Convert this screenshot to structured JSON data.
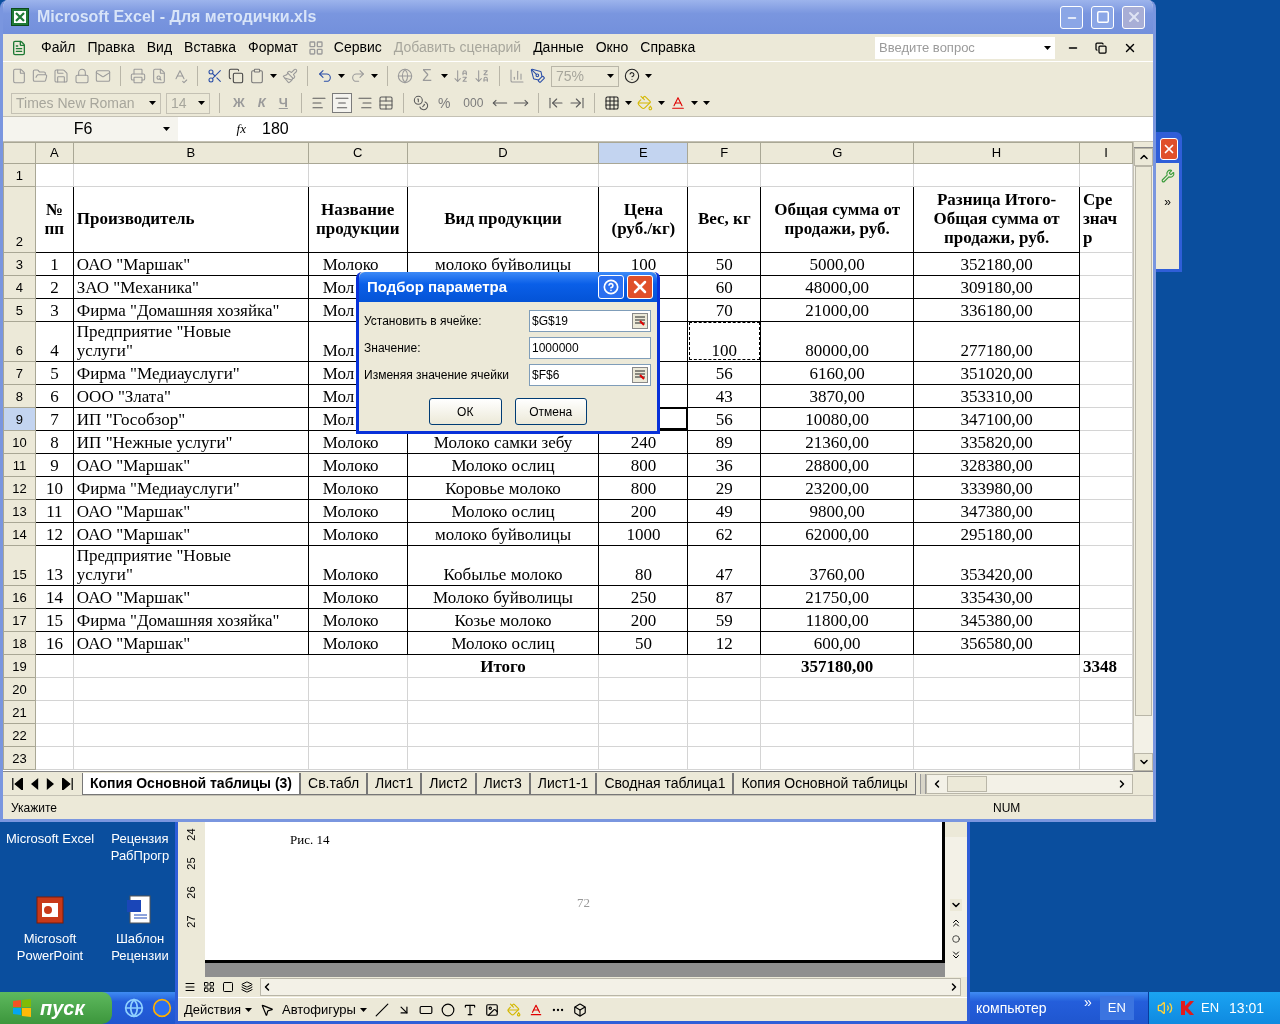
{
  "desktop": {
    "icons": [
      {
        "label": "Microsoft Excel",
        "kind": "label"
      },
      {
        "label": "Рецензия\nРабПрогр",
        "kind": "label"
      },
      {
        "label": "Microsoft\nPowerPoint",
        "kind": "presentation"
      },
      {
        "label": "Шаблон\nРецензии",
        "kind": "document"
      }
    ]
  },
  "side_window": {
    "more": "»"
  },
  "word_window": {
    "ruler": [
      "24",
      "25",
      "26",
      "27"
    ],
    "caption": "Рис. 14",
    "page_number": "72",
    "draw_menu": [
      "Действия",
      "Автофигуры"
    ]
  },
  "taskbar": {
    "start": "пуск",
    "task": "компьютер",
    "more": "»",
    "language": "EN",
    "tray_language": "EN",
    "clock": "13:01"
  },
  "excel": {
    "title": "Microsoft Excel - Для методички.xls",
    "menu": [
      {
        "label": "Файл",
        "disabled": false
      },
      {
        "label": "Правка",
        "disabled": false
      },
      {
        "label": "Вид",
        "disabled": false
      },
      {
        "label": "Вставка",
        "disabled": false
      },
      {
        "label": "Формат",
        "disabled": false
      },
      {
        "label": "Сервис",
        "disabled": false
      },
      {
        "label": "Добавить сценарий",
        "disabled": true
      },
      {
        "label": "Данные",
        "disabled": false
      },
      {
        "label": "Окно",
        "disabled": false
      },
      {
        "label": "Справка",
        "disabled": false
      }
    ],
    "help_search": {
      "placeholder": "Введите вопрос"
    },
    "toolbar": {
      "sum": "Σ",
      "zoom": "75%",
      "font": "Times New Roman",
      "size": "14",
      "bold": "Ж",
      "italic": "К",
      "underline": "Ч",
      "percent": "%",
      "thousands": "000"
    },
    "formula_bar": {
      "name_box": "F6",
      "fx": "fx",
      "value": "180"
    },
    "sheet": {
      "columns": [
        {
          "letter": "A",
          "selected": false
        },
        {
          "letter": "B",
          "selected": false
        },
        {
          "letter": "C",
          "selected": false
        },
        {
          "letter": "D",
          "selected": false
        },
        {
          "letter": "E",
          "selected": true
        },
        {
          "letter": "F",
          "selected": false
        },
        {
          "letter": "G",
          "selected": false
        },
        {
          "letter": "H",
          "selected": false
        },
        {
          "letter": "I",
          "selected": false
        }
      ],
      "rows": [
        {
          "number": "1",
          "kind": "empty",
          "selected": false,
          "marquee": false
        },
        {
          "number": "2",
          "kind": "header",
          "selected": false,
          "marquee": false,
          "cells": [
            "№\nпп",
            "Производитель",
            "Название\nпродукции",
            "Вид продукции",
            "Цена\n(руб./кг)",
            "Вес, кг",
            "Общая сумма от\nпродажи, руб.",
            "Разница Итого-\nОбщая сумма от\nпродажи, руб.",
            "Сре\nзнач\nр"
          ]
        },
        {
          "number": "3",
          "kind": "data",
          "selected": false,
          "marquee": false,
          "cells": [
            "1",
            "ОАО \"Маршак\"",
            "Молоко",
            "молоко буйволицы",
            "100",
            "50",
            "5000,00",
            "352180,00",
            null
          ]
        },
        {
          "number": "4",
          "kind": "data",
          "selected": false,
          "marquee": false,
          "cells": [
            "2",
            "ЗАО \"Механика\"",
            "Мол",
            null,
            null,
            "60",
            "48000,00",
            "309180,00",
            null
          ]
        },
        {
          "number": "5",
          "kind": "data",
          "selected": false,
          "marquee": false,
          "cells": [
            "3",
            "Фирма \"Домашняя хозяйка\"",
            "Мол",
            null,
            null,
            "70",
            "21000,00",
            "336180,00",
            null
          ]
        },
        {
          "number": "6",
          "kind": "data",
          "selected": false,
          "marquee": true,
          "cells": [
            "4",
            "Предприятие \"Новые\nуслуги\"",
            "Мол",
            null,
            null,
            "100",
            "80000,00",
            "277180,00",
            null
          ]
        },
        {
          "number": "7",
          "kind": "data",
          "selected": false,
          "marquee": false,
          "cells": [
            "5",
            "Фирма \"Медиауслуги\"",
            "Мол",
            null,
            null,
            "56",
            "6160,00",
            "351020,00",
            null
          ]
        },
        {
          "number": "8",
          "kind": "data",
          "selected": false,
          "marquee": false,
          "cells": [
            "6",
            "ООО \"Злата\"",
            "Мол",
            null,
            null,
            "43",
            "3870,00",
            "353310,00",
            null
          ]
        },
        {
          "number": "9",
          "kind": "data",
          "selected": true,
          "marquee": false,
          "cells": [
            "7",
            "ИП \"Гособзор\"",
            "Мол",
            null,
            null,
            "56",
            "10080,00",
            "347100,00",
            null
          ]
        },
        {
          "number": "10",
          "kind": "data",
          "selected": false,
          "marquee": false,
          "cells": [
            "8",
            "ИП \"Нежные услуги\"",
            "Молоко",
            "Молоко самки зебу",
            "240",
            "89",
            "21360,00",
            "335820,00",
            null
          ]
        },
        {
          "number": "11",
          "kind": "data",
          "selected": false,
          "marquee": false,
          "cells": [
            "9",
            "ОАО \"Маршак\"",
            "Молоко",
            "Молоко ослиц",
            "800",
            "36",
            "28800,00",
            "328380,00",
            null
          ]
        },
        {
          "number": "12",
          "kind": "data",
          "selected": false,
          "marquee": false,
          "cells": [
            "10",
            "Фирма \"Медиауслуги\"",
            "Молоко",
            "Коровье молоко",
            "800",
            "29",
            "23200,00",
            "333980,00",
            null
          ]
        },
        {
          "number": "13",
          "kind": "data",
          "selected": false,
          "marquee": false,
          "cells": [
            "11",
            "ОАО \"Маршак\"",
            "Молоко",
            "Молоко ослиц",
            "200",
            "49",
            "9800,00",
            "347380,00",
            null
          ]
        },
        {
          "number": "14",
          "kind": "data",
          "selected": false,
          "marquee": false,
          "cells": [
            "12",
            "ОАО \"Маршак\"",
            "Молоко",
            "молоко буйволицы",
            "1000",
            "62",
            "62000,00",
            "295180,00",
            null
          ]
        },
        {
          "number": "15",
          "kind": "data",
          "selected": false,
          "marquee": false,
          "cells": [
            "13",
            "Предприятие \"Новые\nуслуги\"",
            "Молоко",
            "Кобылье молоко",
            "80",
            "47",
            "3760,00",
            "353420,00",
            null
          ]
        },
        {
          "number": "16",
          "kind": "data",
          "selected": false,
          "marquee": false,
          "cells": [
            "14",
            "ОАО \"Маршак\"",
            "Молоко",
            "Молоко буйволицы",
            "250",
            "87",
            "21750,00",
            "335430,00",
            null
          ]
        },
        {
          "number": "17",
          "kind": "data",
          "selected": false,
          "marquee": false,
          "cells": [
            "15",
            "Фирма \"Домашняя хозяйка\"",
            "Молоко",
            "Козье молоко",
            "200",
            "59",
            "11800,00",
            "345380,00",
            null
          ]
        },
        {
          "number": "18",
          "kind": "data",
          "selected": false,
          "marquee": false,
          "cells": [
            "16",
            "ОАО \"Маршак\"",
            "Молоко",
            "Молоко ослиц",
            "50",
            "12",
            "600,00",
            "356580,00",
            null
          ]
        },
        {
          "number": "19",
          "kind": "total",
          "selected": false,
          "marquee": false,
          "cells": [
            null,
            null,
            null,
            "Итого",
            null,
            null,
            "357180,00",
            null,
            "3348"
          ]
        },
        {
          "number": "20",
          "kind": "empty",
          "selected": false,
          "marquee": false
        },
        {
          "number": "21",
          "kind": "empty",
          "selected": false,
          "marquee": false
        },
        {
          "number": "22",
          "kind": "empty",
          "selected": false,
          "marquee": false
        },
        {
          "number": "23",
          "kind": "empty",
          "selected": false,
          "marquee": false
        }
      ]
    },
    "sheet_tabs": [
      {
        "label": "Копия Основной таблицы (3)",
        "selected": true
      },
      {
        "label": "Св.табл",
        "selected": false
      },
      {
        "label": "Лист1",
        "selected": false
      },
      {
        "label": "Лист2",
        "selected": false
      },
      {
        "label": "Лист3",
        "selected": false
      },
      {
        "label": "Лист1-1",
        "selected": false
      },
      {
        "label": "Сводная таблица1",
        "selected": false
      },
      {
        "label": "Копия Основной таблицы",
        "selected": false
      }
    ],
    "status": {
      "message": "Укажите",
      "num": "NUM"
    }
  },
  "dialog": {
    "title": "Подбор параметра",
    "fields": [
      {
        "label": "Установить в ячейке:",
        "value": "$G$19",
        "kind": "reference"
      },
      {
        "label": "Значение:",
        "value": "1000000",
        "kind": "plain"
      },
      {
        "label": "Изменяя значение ячейки",
        "value": "$F$6",
        "kind": "reference"
      }
    ],
    "buttons": [
      "ОК",
      "Отмена"
    ]
  }
}
